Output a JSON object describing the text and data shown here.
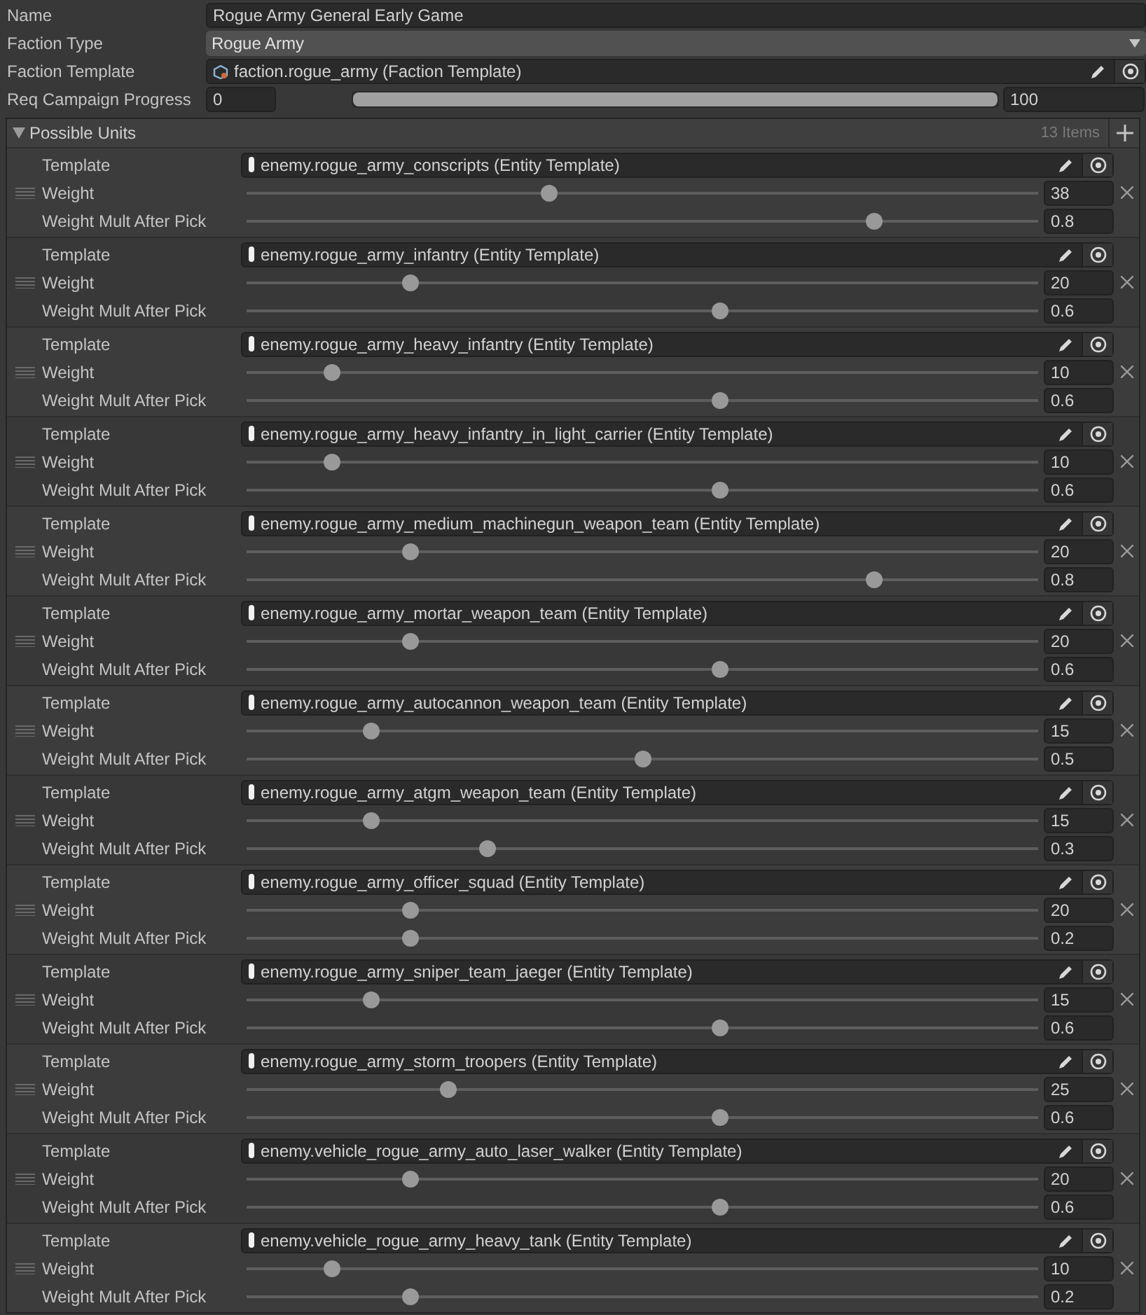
{
  "name": {
    "label": "Name",
    "value": "Rogue Army General Early Game"
  },
  "faction_type": {
    "label": "Faction Type",
    "value": "Rogue Army"
  },
  "faction_template": {
    "label": "Faction Template",
    "value": "faction.rogue_army (Faction Template)"
  },
  "req_campaign_progress": {
    "label": "Req Campaign Progress",
    "min_value": "0",
    "max_value": "100"
  },
  "possible_units": {
    "title": "Possible Units",
    "expanded": true,
    "count": "13 Items",
    "items": [
      {
        "template_label": "Template",
        "template": "enemy.rogue_army_conscripts (Entity Template)",
        "weight": {
          "label": "Weight",
          "value": "38",
          "level": 0.38
        },
        "mult": {
          "label": "Weight Mult After Pick",
          "value": "0.8",
          "level": 0.8
        }
      },
      {
        "template_label": "Template",
        "template": "enemy.rogue_army_infantry (Entity Template)",
        "weight": {
          "label": "Weight",
          "value": "20",
          "level": 0.2
        },
        "mult": {
          "label": "Weight Mult After Pick",
          "value": "0.6",
          "level": 0.6
        }
      },
      {
        "template_label": "Template",
        "template": "enemy.rogue_army_heavy_infantry (Entity Template)",
        "weight": {
          "label": "Weight",
          "value": "10",
          "level": 0.1
        },
        "mult": {
          "label": "Weight Mult After Pick",
          "value": "0.6",
          "level": 0.6
        }
      },
      {
        "template_label": "Template",
        "template": "enemy.rogue_army_heavy_infantry_in_light_carrier (Entity Template)",
        "weight": {
          "label": "Weight",
          "value": "10",
          "level": 0.1
        },
        "mult": {
          "label": "Weight Mult After Pick",
          "value": "0.6",
          "level": 0.6
        }
      },
      {
        "template_label": "Template",
        "template": "enemy.rogue_army_medium_machinegun_weapon_team (Entity Template)",
        "weight": {
          "label": "Weight",
          "value": "20",
          "level": 0.2
        },
        "mult": {
          "label": "Weight Mult After Pick",
          "value": "0.8",
          "level": 0.8
        }
      },
      {
        "template_label": "Template",
        "template": "enemy.rogue_army_mortar_weapon_team (Entity Template)",
        "weight": {
          "label": "Weight",
          "value": "20",
          "level": 0.2
        },
        "mult": {
          "label": "Weight Mult After Pick",
          "value": "0.6",
          "level": 0.6
        }
      },
      {
        "template_label": "Template",
        "template": "enemy.rogue_army_autocannon_weapon_team (Entity Template)",
        "weight": {
          "label": "Weight",
          "value": "15",
          "level": 0.15
        },
        "mult": {
          "label": "Weight Mult After Pick",
          "value": "0.5",
          "level": 0.5
        }
      },
      {
        "template_label": "Template",
        "template": "enemy.rogue_army_atgm_weapon_team (Entity Template)",
        "weight": {
          "label": "Weight",
          "value": "15",
          "level": 0.15
        },
        "mult": {
          "label": "Weight Mult After Pick",
          "value": "0.3",
          "level": 0.3
        }
      },
      {
        "template_label": "Template",
        "template": "enemy.rogue_army_officer_squad (Entity Template)",
        "weight": {
          "label": "Weight",
          "value": "20",
          "level": 0.2
        },
        "mult": {
          "label": "Weight Mult After Pick",
          "value": "0.2",
          "level": 0.2
        }
      },
      {
        "template_label": "Template",
        "template": "enemy.rogue_army_sniper_team_jaeger (Entity Template)",
        "weight": {
          "label": "Weight",
          "value": "15",
          "level": 0.15
        },
        "mult": {
          "label": "Weight Mult After Pick",
          "value": "0.6",
          "level": 0.6
        }
      },
      {
        "template_label": "Template",
        "template": "enemy.rogue_army_storm_troopers (Entity Template)",
        "weight": {
          "label": "Weight",
          "value": "25",
          "level": 0.25
        },
        "mult": {
          "label": "Weight Mult After Pick",
          "value": "0.6",
          "level": 0.6
        }
      },
      {
        "template_label": "Template",
        "template": "enemy.vehicle_rogue_army_auto_laser_walker (Entity Template)",
        "weight": {
          "label": "Weight",
          "value": "20",
          "level": 0.2
        },
        "mult": {
          "label": "Weight Mult After Pick",
          "value": "0.6",
          "level": 0.6
        }
      },
      {
        "template_label": "Template",
        "template": "enemy.vehicle_rogue_army_heavy_tank (Entity Template)",
        "weight": {
          "label": "Weight",
          "value": "10",
          "level": 0.1
        },
        "mult": {
          "label": "Weight Mult After Pick",
          "value": "0.2",
          "level": 0.2
        }
      }
    ]
  }
}
